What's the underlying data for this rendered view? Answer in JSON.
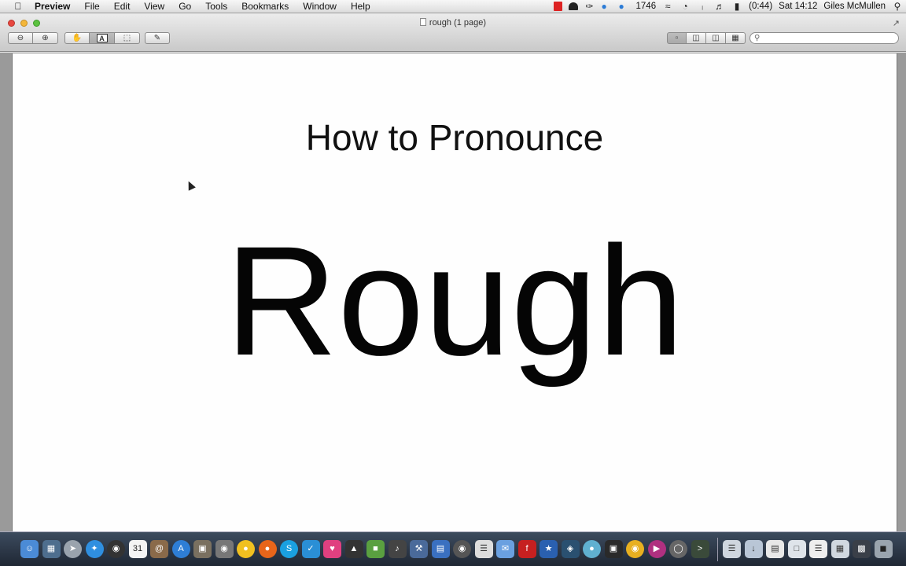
{
  "menubar": {
    "apple_icon": "apple-icon",
    "app_name": "Preview",
    "menus": [
      "File",
      "Edit",
      "View",
      "Go",
      "Tools",
      "Bookmarks",
      "Window",
      "Help"
    ],
    "status": {
      "tweet_count": "1746",
      "battery_time": "(0:44)",
      "clock": "Sat 14:12",
      "user": "Giles McMullen"
    }
  },
  "window": {
    "title": "rough (1 page)",
    "toolbar": {
      "zoom_out": "zoom-out-icon",
      "zoom_in": "zoom-in-icon",
      "text_select_label": "A",
      "search_placeholder": ""
    }
  },
  "document": {
    "heading": "How to Pronounce",
    "word": "Rough"
  },
  "dock": {
    "icons": [
      "finder",
      "mission-control",
      "launchpad",
      "safari",
      "dashboard",
      "calendar",
      "address-book",
      "app-store",
      "preview",
      "photo-booth",
      "cyberduck",
      "firefox",
      "skype",
      "twitterrific",
      "itunes",
      "vpn",
      "evernote",
      "garageband",
      "xcode",
      "keynote",
      "dvd-player",
      "textedit",
      "mail",
      "flash",
      "photos",
      "news",
      "maps",
      "stage",
      "chrome",
      "music",
      "instruments",
      "terminal"
    ],
    "stack_icons": [
      "documents",
      "downloads",
      "folder",
      "files",
      "notes",
      "applications",
      "screen",
      "trash"
    ]
  }
}
